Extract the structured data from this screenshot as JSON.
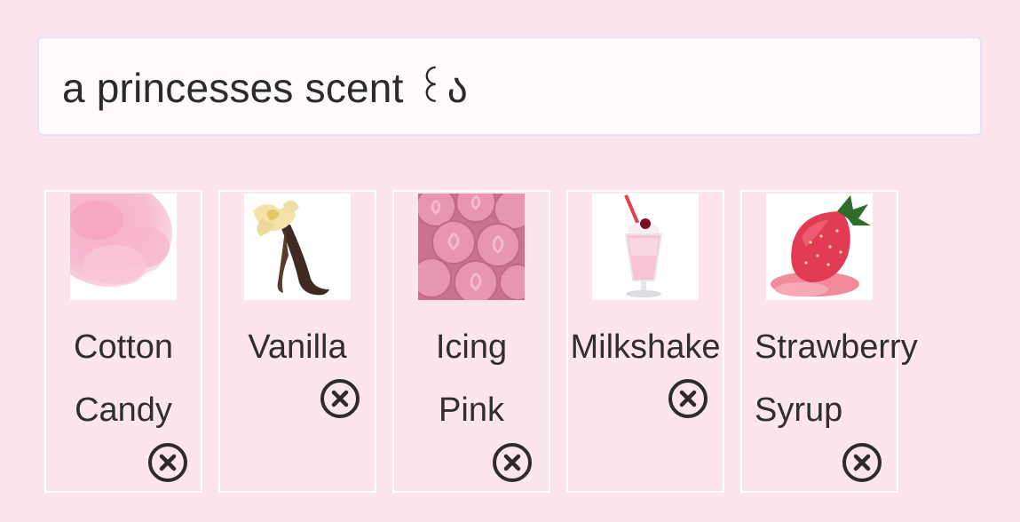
{
  "name_field": {
    "value": "a princesses scent ꒰ა"
  },
  "cards": [
    {
      "label": "Cotton\nCandy",
      "image_icon": "cotton-candy-image",
      "remove_icon": "close-circle-icon"
    },
    {
      "label": "Vanilla",
      "image_icon": "vanilla-image",
      "remove_icon": "close-circle-icon"
    },
    {
      "label": "Icing\nPink",
      "image_icon": "pink-icing-image",
      "remove_icon": "close-circle-icon"
    },
    {
      "label": "Milkshake",
      "image_icon": "milkshake-image",
      "remove_icon": "close-circle-icon"
    },
    {
      "label": "Strawberry\nSyrup",
      "image_icon": "strawberry-image",
      "remove_icon": "close-circle-icon"
    }
  ],
  "colors": {
    "background": "#fde5ee",
    "field_background": "#fefafc",
    "field_border": "#e4e4f8",
    "card_border": "#ffffff",
    "text": "#2f2f2f"
  }
}
